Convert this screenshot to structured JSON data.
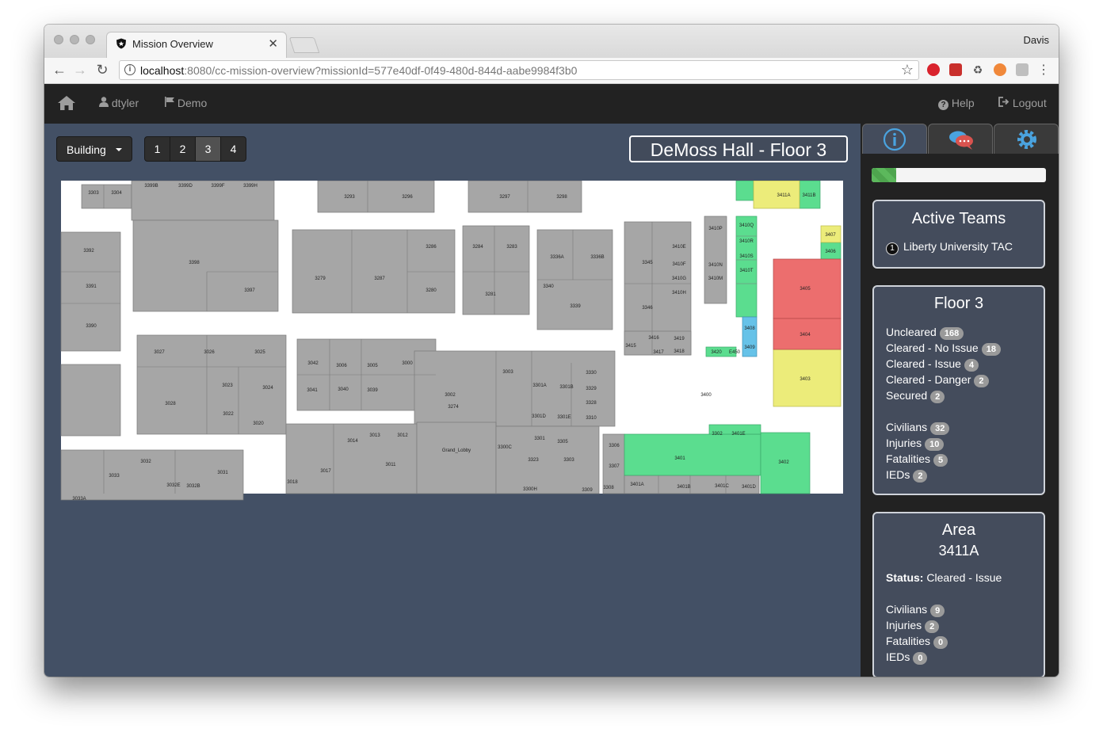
{
  "browser": {
    "tab_title": "Mission Overview",
    "profile_name": "Davis",
    "url_host": "localhost",
    "url_rest": ":8080/cc-mission-overview?missionId=577e40df-0f49-480d-844d-aabe9984f3b0"
  },
  "navbar": {
    "user": "dtyler",
    "mission": "Demo",
    "help": "Help",
    "logout": "Logout"
  },
  "controls": {
    "building_label": "Building",
    "floors": [
      "1",
      "2",
      "3",
      "4"
    ],
    "active_floor": "3",
    "floor_title": "DeMoss Hall - Floor 3"
  },
  "map": {
    "room_labels": {
      "r3303": "3303",
      "r3304": "3304",
      "r3399A": "3399A",
      "r3399B": "3399B",
      "r3399D": "3399D",
      "r3399F": "3399F",
      "r3399H": "3399H",
      "r3293": "3293",
      "r3296": "3296",
      "r3297": "3297",
      "r3298": "3298",
      "r3392": "3392",
      "r3398": "3398",
      "r3397": "3397",
      "r3391": "3391",
      "r3390": "3390",
      "r3279": "3279",
      "r3287": "3287",
      "r3286": "3286",
      "r3280": "3280",
      "r3284": "3284",
      "r3283": "3283",
      "r3281": "3281",
      "r3336A": "3336A",
      "r3336B": "3336B",
      "r3340": "3340",
      "r3339": "3339",
      "r3345": "3345",
      "r3346": "3346",
      "r3410E": "3410E",
      "r3410F": "3410F",
      "r3410G": "3410G",
      "r3410H": "3410H",
      "r3410P": "3410P",
      "r3410N": "3410N",
      "r3410M": "3410M",
      "r3410Q": "3410Q",
      "r3410R": "3410R",
      "r3410S": "3410S",
      "r3410T": "3410T",
      "r3411A": "3411A",
      "r3411B": "3411B",
      "r3407": "3407",
      "r3406": "3406",
      "r3405": "3405",
      "r3404": "3404",
      "r3403": "3403",
      "r3027": "3027",
      "r3026": "3026",
      "r3025": "3025",
      "r3023": "3023",
      "r3024": "3024",
      "r3028": "3028",
      "r3022": "3022",
      "r3020": "3020",
      "r3042": "3042",
      "r3006": "3006",
      "r3005": "3005",
      "r3000": "3000",
      "r3041": "3041",
      "r3040": "3040",
      "r3039": "3039",
      "r3003": "3003",
      "r3002": "3002",
      "r3274": "3274",
      "r3301A": "3301A",
      "r3301B": "3301B",
      "r3301D": "3301D",
      "r3301E": "3301E",
      "r3329": "3329",
      "r3328": "3328",
      "r3310": "3310",
      "r3330": "3330",
      "r3014": "3014",
      "r3013": "3013",
      "r3012": "3012",
      "r3011": "3011",
      "r3017": "3017",
      "r3018": "3018",
      "grand_lobby": "Grand_Lobby",
      "r3300C": "3300C",
      "r3301": "3301",
      "r3305": "3305",
      "r3323": "3323",
      "r3303b": "3303",
      "r3300H": "3300H",
      "r3400": "3400",
      "r3401": "3401",
      "r3402": "3402",
      "r3401E": "3401E",
      "r3302": "3302",
      "r3401A": "3401A",
      "r3401B": "3401B",
      "r3401C": "3401C",
      "r3401D": "3401D",
      "r3306": "3306",
      "r3307": "3307",
      "r3308": "3308",
      "r3309": "3309",
      "r3032": "3032",
      "r3033": "3033",
      "r3031": "3031",
      "r3033A": "3033A",
      "r3032E": "3032E",
      "r3032B": "3032B",
      "r3416": "3416",
      "r3415": "3415",
      "r3417": "3417",
      "r3418": "3418",
      "r3419": "3419",
      "r3420": "3420",
      "rE450": "E450",
      "r3408": "3408",
      "r3409": "3409"
    }
  },
  "sidebar": {
    "progress_fraction": 0.14,
    "active_teams": {
      "title": "Active Teams",
      "teams": [
        {
          "number": "1",
          "name": "Liberty University TAC"
        }
      ]
    },
    "floor": {
      "title": "Floor 3",
      "stats": [
        {
          "label": "Uncleared",
          "count": "168"
        },
        {
          "label": "Cleared - No Issue",
          "count": "18"
        },
        {
          "label": "Cleared - Issue",
          "count": "4"
        },
        {
          "label": "Cleared - Danger",
          "count": "2"
        },
        {
          "label": "Secured",
          "count": "2"
        }
      ],
      "people": [
        {
          "label": "Civilians",
          "count": "32"
        },
        {
          "label": "Injuries",
          "count": "10"
        },
        {
          "label": "Fatalities",
          "count": "5"
        },
        {
          "label": "IEDs",
          "count": "2"
        }
      ]
    },
    "area": {
      "title": "Area",
      "name": "3411A",
      "status_label": "Status:",
      "status_value": "Cleared - Issue",
      "people": [
        {
          "label": "Civilians",
          "count": "9"
        },
        {
          "label": "Injuries",
          "count": "2"
        },
        {
          "label": "Fatalities",
          "count": "0"
        },
        {
          "label": "IEDs",
          "count": "0"
        }
      ]
    }
  },
  "colors": {
    "app_bg": "#435065",
    "navbar_bg": "#222222",
    "room_uncleared": "#a6a6a6",
    "room_cleared_no_issue": "#5bdd8f",
    "room_cleared_issue": "#ecec7a",
    "room_cleared_danger": "#ec6e6e",
    "room_secured": "#66c2e8"
  },
  "icons": [
    "shield-icon",
    "home-icon",
    "user-icon",
    "flag-icon",
    "help-icon",
    "logout-icon",
    "info-icon",
    "chat-icon",
    "gear-icon"
  ]
}
